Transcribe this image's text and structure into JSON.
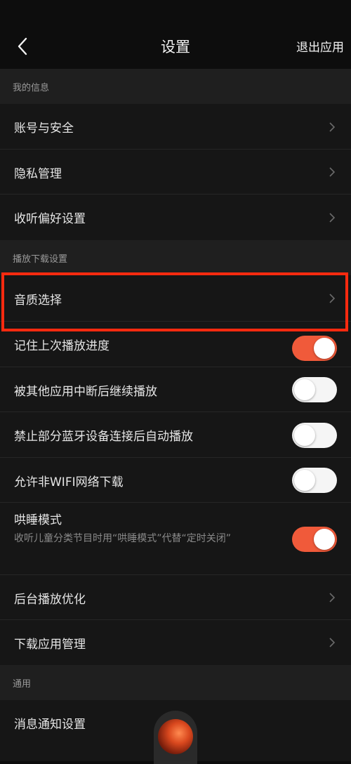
{
  "header": {
    "title": "设置",
    "exit_label": "退出应用",
    "back_icon": "chevron-left-icon"
  },
  "sections": {
    "my_info": {
      "title": "我的信息",
      "items": [
        "账号与安全",
        "隐私管理",
        "收听偏好设置"
      ]
    },
    "playback": {
      "title": "播放下载设置",
      "audio_quality": "音质选择",
      "remember_progress": "记住上次播放进度",
      "resume_after_interrupt": "被其他应用中断后继续播放",
      "block_bluetooth_autoplay": "禁止部分蓝牙设备连接后自动播放",
      "allow_non_wifi": "允许非WIFI网络下载",
      "sleep_mode": {
        "label": "哄睡模式",
        "description": "收听儿童分类节目时用“哄睡模式”代替“定时关闭”"
      },
      "background_optimize": "后台播放优化",
      "download_manage": "下载应用管理"
    },
    "general": {
      "title": "通用",
      "notification": "消息通知设置"
    }
  },
  "toggles": {
    "remember_progress": true,
    "resume_after_interrupt": false,
    "block_bluetooth_autoplay": false,
    "allow_non_wifi": false,
    "sleep_mode": true
  },
  "colors": {
    "accent": "#f05a3a",
    "highlight_border": "#ff2a0f"
  }
}
